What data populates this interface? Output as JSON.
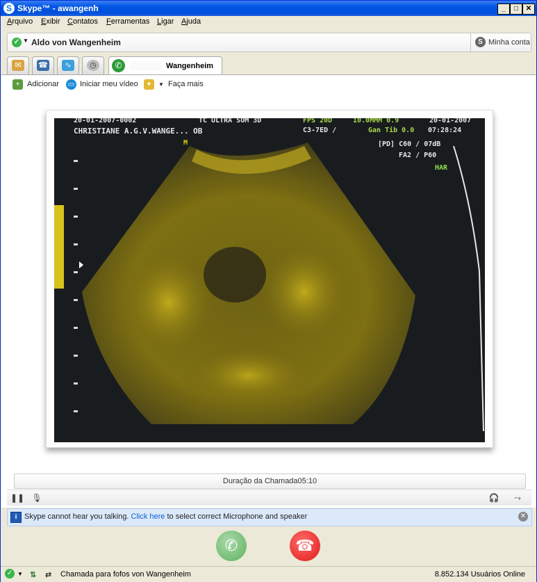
{
  "window": {
    "title": "Skype™ - awangenh",
    "app_icon": "skype-icon",
    "controls": [
      "minimize",
      "maximize",
      "close"
    ]
  },
  "menu": {
    "items": [
      "Arquivo",
      "Exibir",
      "Contatos",
      "Ferramentas",
      "Ligar",
      "Ajuda"
    ]
  },
  "contact_bar": {
    "name": "Aldo von Wangenheim",
    "account_label": "Minha conta"
  },
  "tabs": {
    "icons": [
      "contacts-icon",
      "phone-icon",
      "live-icon",
      "history-icon"
    ],
    "active_label": "Wangenheim"
  },
  "toolbar": {
    "add_label": "Adicionar",
    "video_label": "Iniciar meu vídeo",
    "more_label": "Faça mais"
  },
  "video": {
    "overlay": {
      "line1_left": "20-01-2007-0002",
      "line1_mid": "TC ULTRA SOM 3D",
      "line1_fps": "FPS 20D",
      "line1_mm": "10.0MMM 0.9",
      "line1_date": "20-01-2007",
      "line2_name": "CHRISTIANE A.G.V.WANGE... OB",
      "line2_mid": "C3-7ED /",
      "line2_gain": "Gan Tib 0.0",
      "line2_time": "07:28:24",
      "line3": "[PD] C60 / 07dB",
      "line4": "FA2 / P60",
      "line5": "HAR",
      "marker": "M"
    },
    "accent_color": "#c9b11c"
  },
  "call": {
    "duration_label": "Duração da Chamada",
    "duration_value": "05:10"
  },
  "notice": {
    "before": "Skype cannot hear you talking.",
    "link": "Click here",
    "after": "to select correct Microphone and speaker"
  },
  "status": {
    "call_text": "Chamada para fofos von Wangenheim",
    "online_count": "8.852.134 Usuários Online"
  },
  "colors": {
    "accept": "#5fb25f",
    "hangup": "#e01a1a",
    "titlebar": "#0054e3"
  }
}
